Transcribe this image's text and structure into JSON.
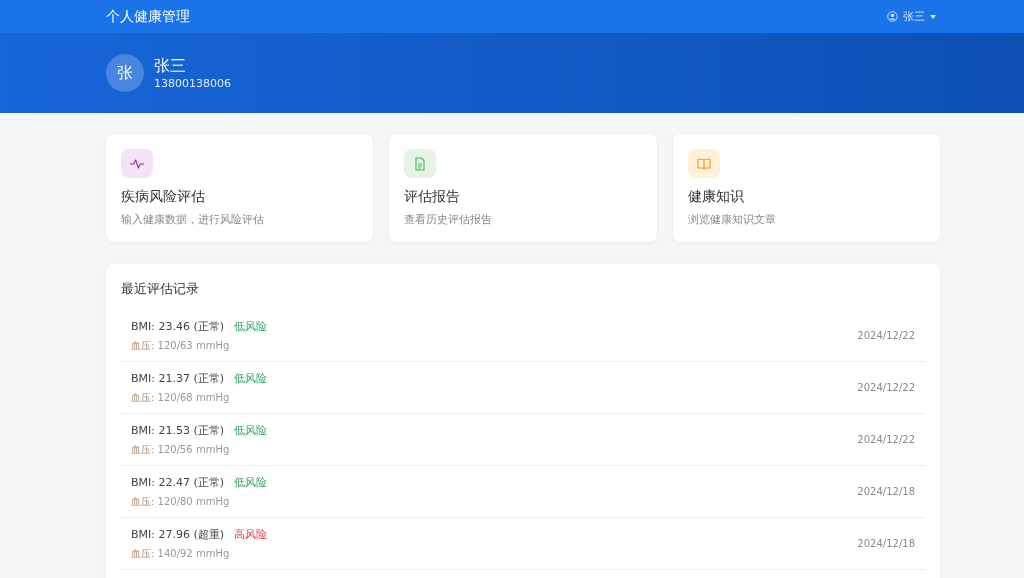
{
  "navbar": {
    "title": "个人健康管理",
    "user": "张三"
  },
  "profile": {
    "avatar": "张",
    "name": "张三",
    "phone": "13800138006"
  },
  "cards": [
    {
      "kind": "pulse",
      "title": "疾病风险评估",
      "description": "输入健康数据，进行风险评估"
    },
    {
      "kind": "document",
      "title": "评估报告",
      "description": "查看历史评估报告"
    },
    {
      "kind": "book",
      "title": "健康知识",
      "description": "浏览健康知识文章"
    }
  ],
  "recent": {
    "title": "最近评估记录",
    "records": [
      {
        "bmi": "BMI: 23.46 (正常)",
        "risk": "低风险",
        "kind": "low",
        "pressure_label": "血压",
        "pressure": ": 120/63 mmHg",
        "date": "2024/12/22"
      },
      {
        "bmi": "BMI: 21.37 (正常)",
        "risk": "低风险",
        "kind": "low",
        "pressure_label": "血压",
        "pressure": ": 120/68 mmHg",
        "date": "2024/12/22"
      },
      {
        "bmi": "BMI: 21.53 (正常)",
        "risk": "低风险",
        "kind": "low",
        "pressure_label": "血压",
        "pressure": ": 120/56 mmHg",
        "date": "2024/12/22"
      },
      {
        "bmi": "BMI: 22.47 (正常)",
        "risk": "低风险",
        "kind": "low",
        "pressure_label": "血压",
        "pressure": ": 120/80 mmHg",
        "date": "2024/12/18"
      },
      {
        "bmi": "BMI: 27.96 (超重)",
        "risk": "高风险",
        "kind": "high",
        "pressure_label": "血压",
        "pressure": ": 140/92 mmHg",
        "date": "2024/12/18"
      }
    ]
  }
}
